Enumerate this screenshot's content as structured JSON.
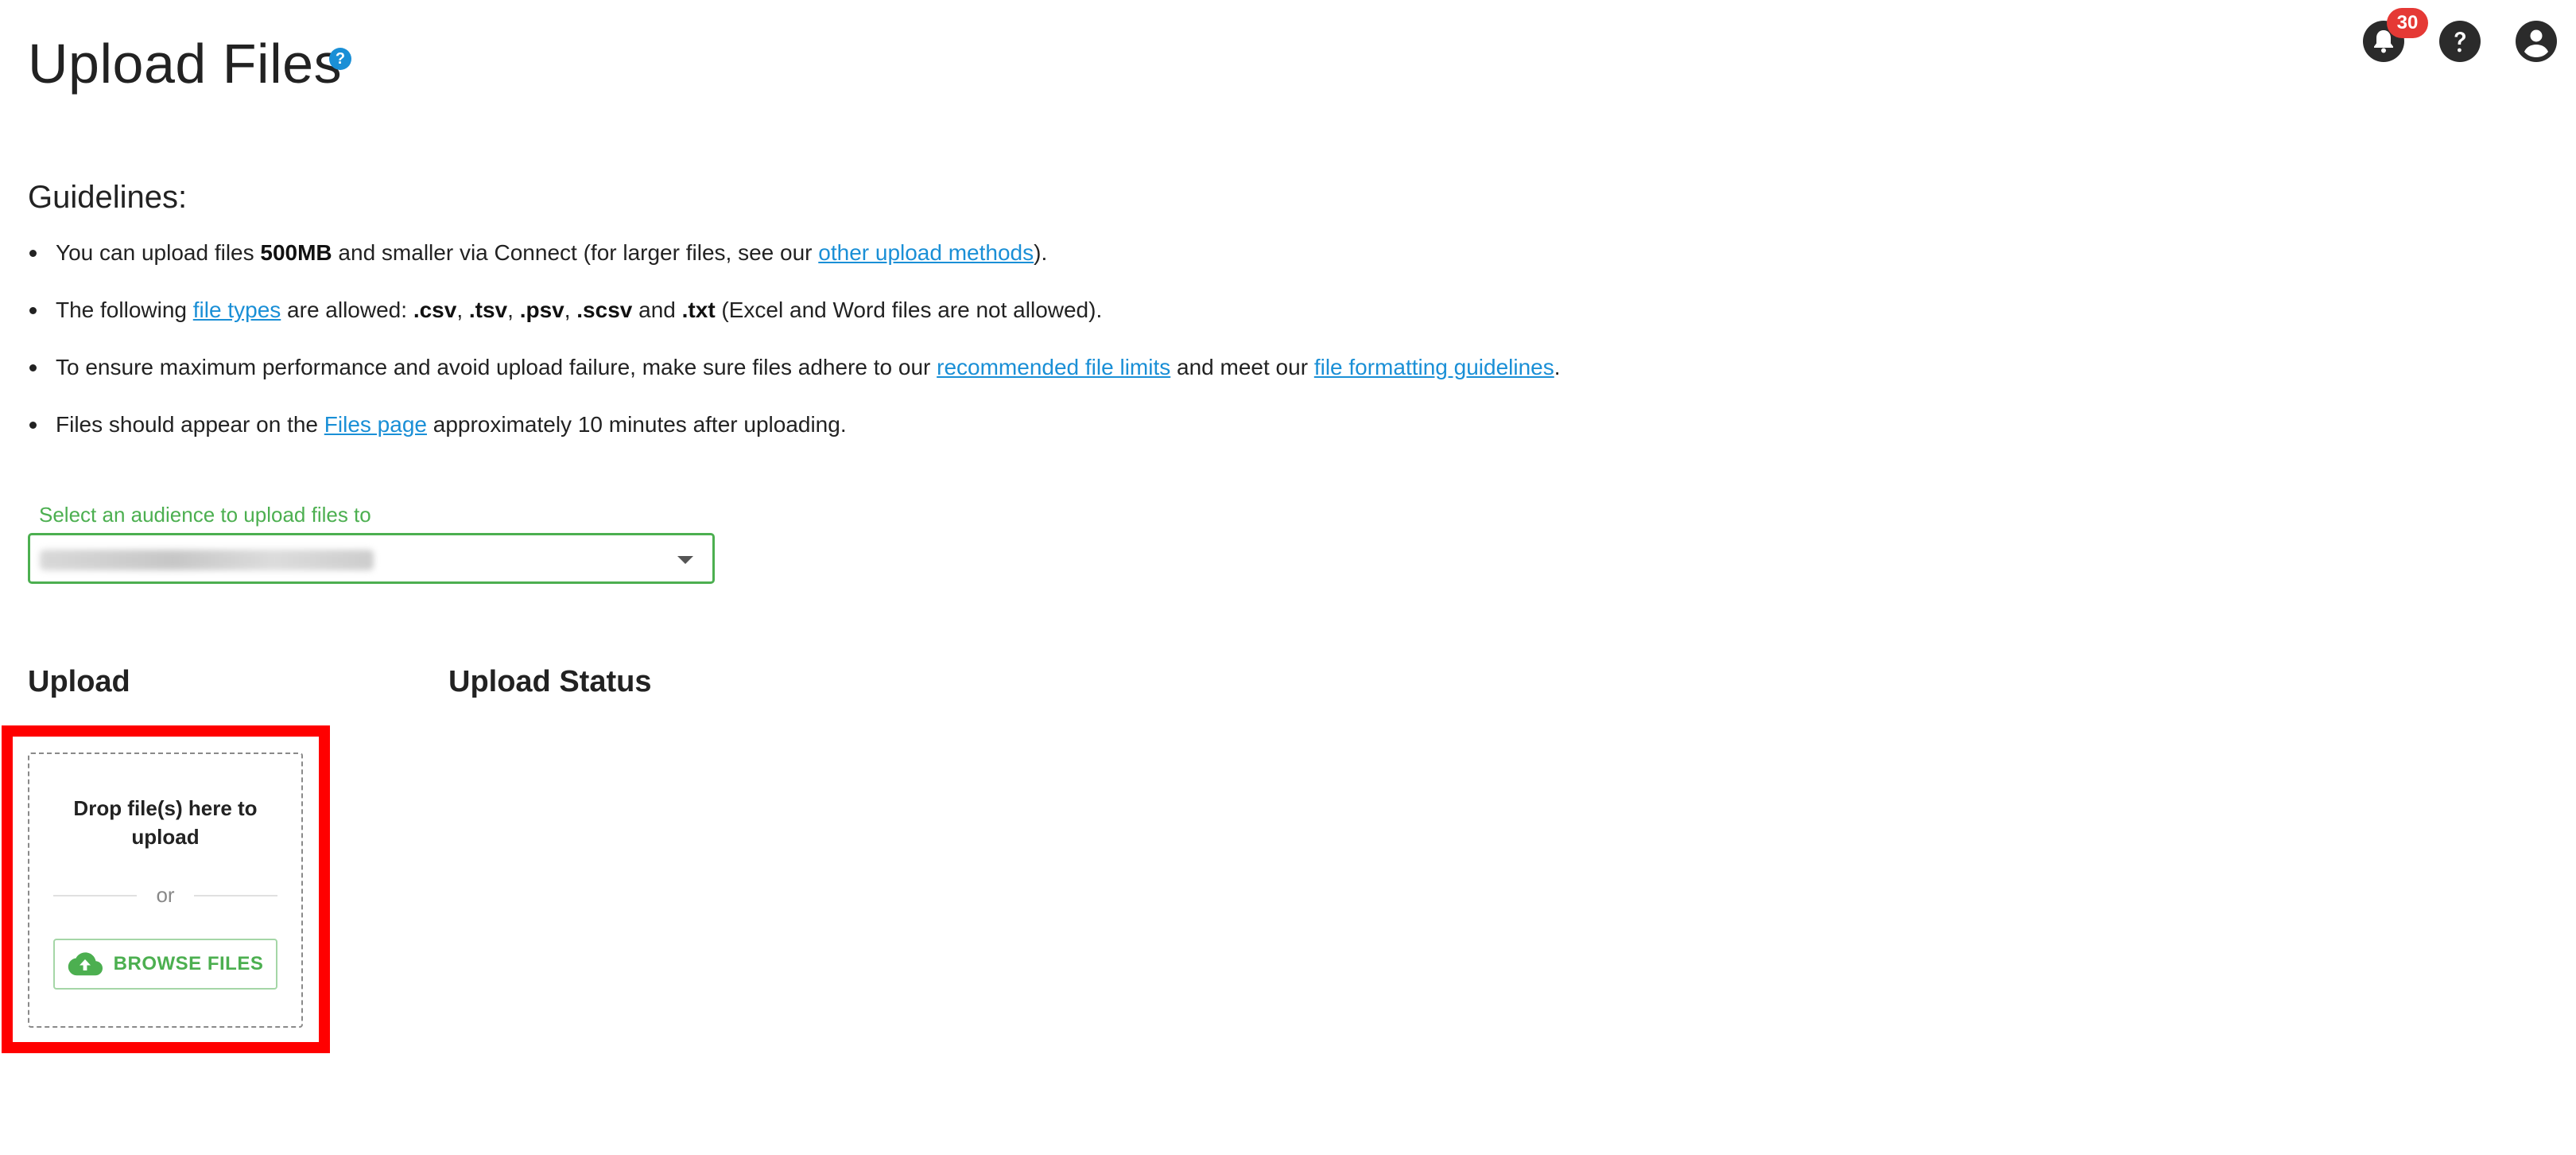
{
  "header": {
    "title": "Upload Files",
    "help_glyph": "?",
    "notification_count": "30",
    "icons": [
      "bell-icon",
      "help-icon",
      "account-icon"
    ]
  },
  "guidelines": {
    "heading": "Guidelines:",
    "items": [
      {
        "parts": [
          {
            "type": "text",
            "value": "You can upload files "
          },
          {
            "type": "bold",
            "value": "500MB"
          },
          {
            "type": "text",
            "value": " and smaller via Connect (for larger files, see our "
          },
          {
            "type": "link",
            "value": "other upload methods"
          },
          {
            "type": "text",
            "value": ")."
          }
        ]
      },
      {
        "parts": [
          {
            "type": "text",
            "value": "The following "
          },
          {
            "type": "link",
            "value": "file types"
          },
          {
            "type": "text",
            "value": " are allowed: "
          },
          {
            "type": "bold",
            "value": ".csv"
          },
          {
            "type": "text",
            "value": ", "
          },
          {
            "type": "bold",
            "value": ".tsv"
          },
          {
            "type": "text",
            "value": ", "
          },
          {
            "type": "bold",
            "value": ".psv"
          },
          {
            "type": "text",
            "value": ", "
          },
          {
            "type": "bold",
            "value": ".scsv"
          },
          {
            "type": "text",
            "value": " and "
          },
          {
            "type": "bold",
            "value": ".txt"
          },
          {
            "type": "text",
            "value": " (Excel and Word files are not allowed)."
          }
        ]
      },
      {
        "parts": [
          {
            "type": "text",
            "value": "To ensure maximum performance and avoid upload failure, make sure files adhere to our "
          },
          {
            "type": "link",
            "value": "recommended file limits"
          },
          {
            "type": "text",
            "value": " and meet our "
          },
          {
            "type": "link",
            "value": "file formatting guidelines"
          },
          {
            "type": "text",
            "value": "."
          }
        ]
      },
      {
        "parts": [
          {
            "type": "text",
            "value": "Files should appear on the "
          },
          {
            "type": "link",
            "value": "Files page"
          },
          {
            "type": "text",
            "value": " approximately 10 minutes after uploading."
          }
        ]
      }
    ]
  },
  "audience": {
    "label": "Select an audience to upload files to"
  },
  "upload": {
    "heading": "Upload",
    "drop_text": "Drop file(s) here to upload",
    "or_text": "or",
    "browse_label": "BROWSE FILES"
  },
  "status": {
    "heading": "Upload Status"
  },
  "colors": {
    "link": "#1a8fd6",
    "accent_green": "#4caf50",
    "highlight_red": "#ff0000",
    "badge_red": "#e53935"
  }
}
